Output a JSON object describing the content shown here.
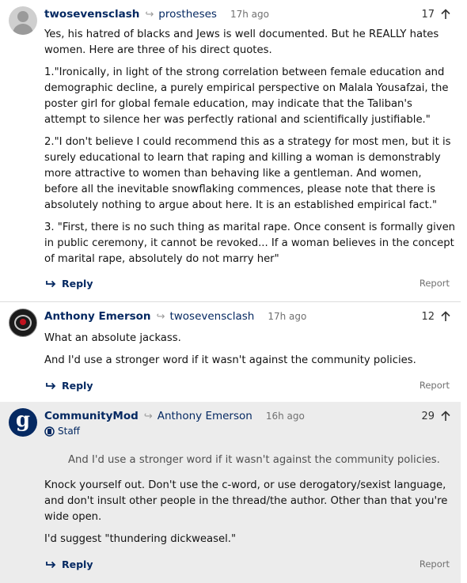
{
  "comments": [
    {
      "author": "twosevensclash",
      "reply_to": "prostheses",
      "time": "17h ago",
      "votes": "17",
      "paragraphs": [
        "Yes, his hatred of blacks and Jews is well documented. But he REALLY hates women. Here are three of his direct quotes.",
        "1.\"Ironically, in light of the strong correlation between female education and demographic decline, a purely empirical perspective on Malala Yousafzai, the poster girl for global female education, may indicate that the Taliban's attempt to silence her was perfectly rational and scientifically justifiable.\"",
        "2.\"I don't believe I could recommend this as a strategy for most men, but it is surely educational to learn that raping and killing a woman is demonstrably more attractive to women than behaving like a gentleman. And women, before all the inevitable snowflaking commences, please note that there is absolutely nothing to argue about here. It is an established empirical fact.\"",
        "3. \"First, there is no such thing as marital rape. Once consent is formally given in public ceremony, it cannot be revoked... If a woman believes in the concept of marital rape, absolutely do not marry her\""
      ],
      "reply_label": "Reply",
      "report_label": "Report"
    },
    {
      "author": "Anthony Emerson",
      "reply_to": "twosevensclash",
      "time": "17h ago",
      "votes": "12",
      "paragraphs": [
        "What an absolute jackass.",
        "And I'd use a stronger word if it wasn't against the community policies."
      ],
      "reply_label": "Reply",
      "report_label": "Report"
    },
    {
      "author": "CommunityMod",
      "reply_to": "Anthony Emerson",
      "time": "16h ago",
      "votes": "29",
      "staff_label": "Staff",
      "avatar_letter": "g",
      "quote": "And I'd use a stronger word if it wasn't against the community policies.",
      "paragraphs": [
        "Knock yourself out. Don't use the c-word, or use derogatory/sexist language, and don't insult other people in the thread/the author. Other than that you're wide open.",
        "I'd suggest \"thundering dickweasel.\""
      ],
      "reply_label": "Reply",
      "report_label": "Report"
    }
  ],
  "icons": {
    "reply_arrow": "reply-arrow-icon",
    "upvote": "upvote-arrow-icon",
    "reply": "reply-icon",
    "staff": "staff-badge-icon"
  },
  "colors": {
    "accent": "#052962",
    "mod_background": "#ececec",
    "muted": "#707070"
  }
}
